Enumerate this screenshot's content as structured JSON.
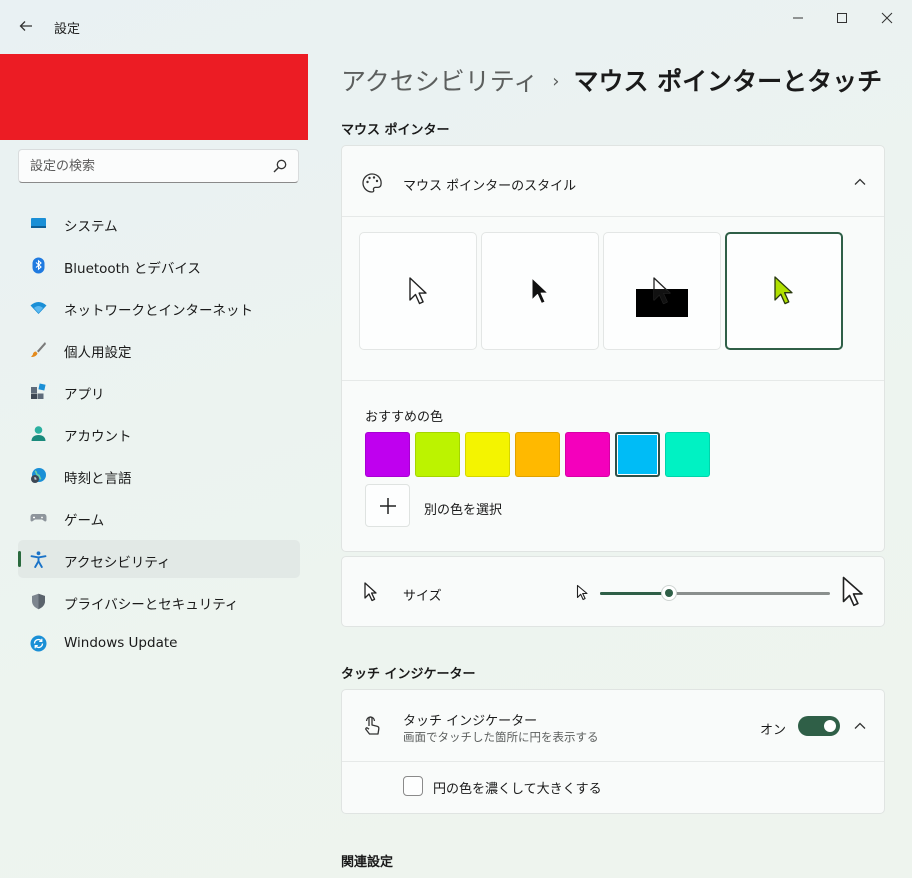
{
  "window": {
    "title": "設定"
  },
  "sidebar": {
    "search_placeholder": "設定の検索",
    "items": [
      {
        "label": "システム",
        "icon": "system-icon"
      },
      {
        "label": "Bluetooth とデバイス",
        "icon": "bluetooth-icon"
      },
      {
        "label": "ネットワークとインターネット",
        "icon": "network-icon"
      },
      {
        "label": "個人用設定",
        "icon": "personalization-brush-icon"
      },
      {
        "label": "アプリ",
        "icon": "apps-icon"
      },
      {
        "label": "アカウント",
        "icon": "account-icon"
      },
      {
        "label": "時刻と言語",
        "icon": "time-language-icon"
      },
      {
        "label": "ゲーム",
        "icon": "gaming-icon"
      },
      {
        "label": "アクセシビリティ",
        "icon": "accessibility-icon",
        "active": true
      },
      {
        "label": "プライバシーとセキュリティ",
        "icon": "privacy-shield-icon"
      },
      {
        "label": "Windows Update",
        "icon": "windows-update-icon"
      }
    ]
  },
  "breadcrumb": {
    "parent": "アクセシビリティ",
    "separator": "›",
    "current": "マウス ポインターとタッチ"
  },
  "mouse_pointer": {
    "section_title": "マウス ポインター",
    "style_card_title": "マウス ポインターのスタイル",
    "styles": [
      {
        "name": "white",
        "selected": false
      },
      {
        "name": "black",
        "selected": false
      },
      {
        "name": "inverted",
        "selected": false
      },
      {
        "name": "custom",
        "selected": true
      }
    ],
    "recommended_colors_label": "おすすめの色",
    "recommended_colors": [
      "#bf00ef",
      "#bcf300",
      "#f4f400",
      "#ffb900",
      "#f400bc",
      "#00bcf6",
      "#00f2c3"
    ],
    "selected_color_index": 5,
    "custom_pointer_color": "#b0e000",
    "add_color_label": "別の色を選択",
    "size_label": "サイズ",
    "size_value": 0.3
  },
  "touch_indicator": {
    "section_title": "タッチ インジケーター",
    "title": "タッチ インジケーター",
    "description": "画面でタッチした箇所に円を表示する",
    "state_label": "オン",
    "enabled": true,
    "darker_circle_label": "円の色を濃くして大きくする",
    "darker_circle_checked": false
  },
  "related": {
    "section_title": "関連設定"
  },
  "colors": {
    "accent": "#2f5f47",
    "redaction": "#ec1c24"
  }
}
